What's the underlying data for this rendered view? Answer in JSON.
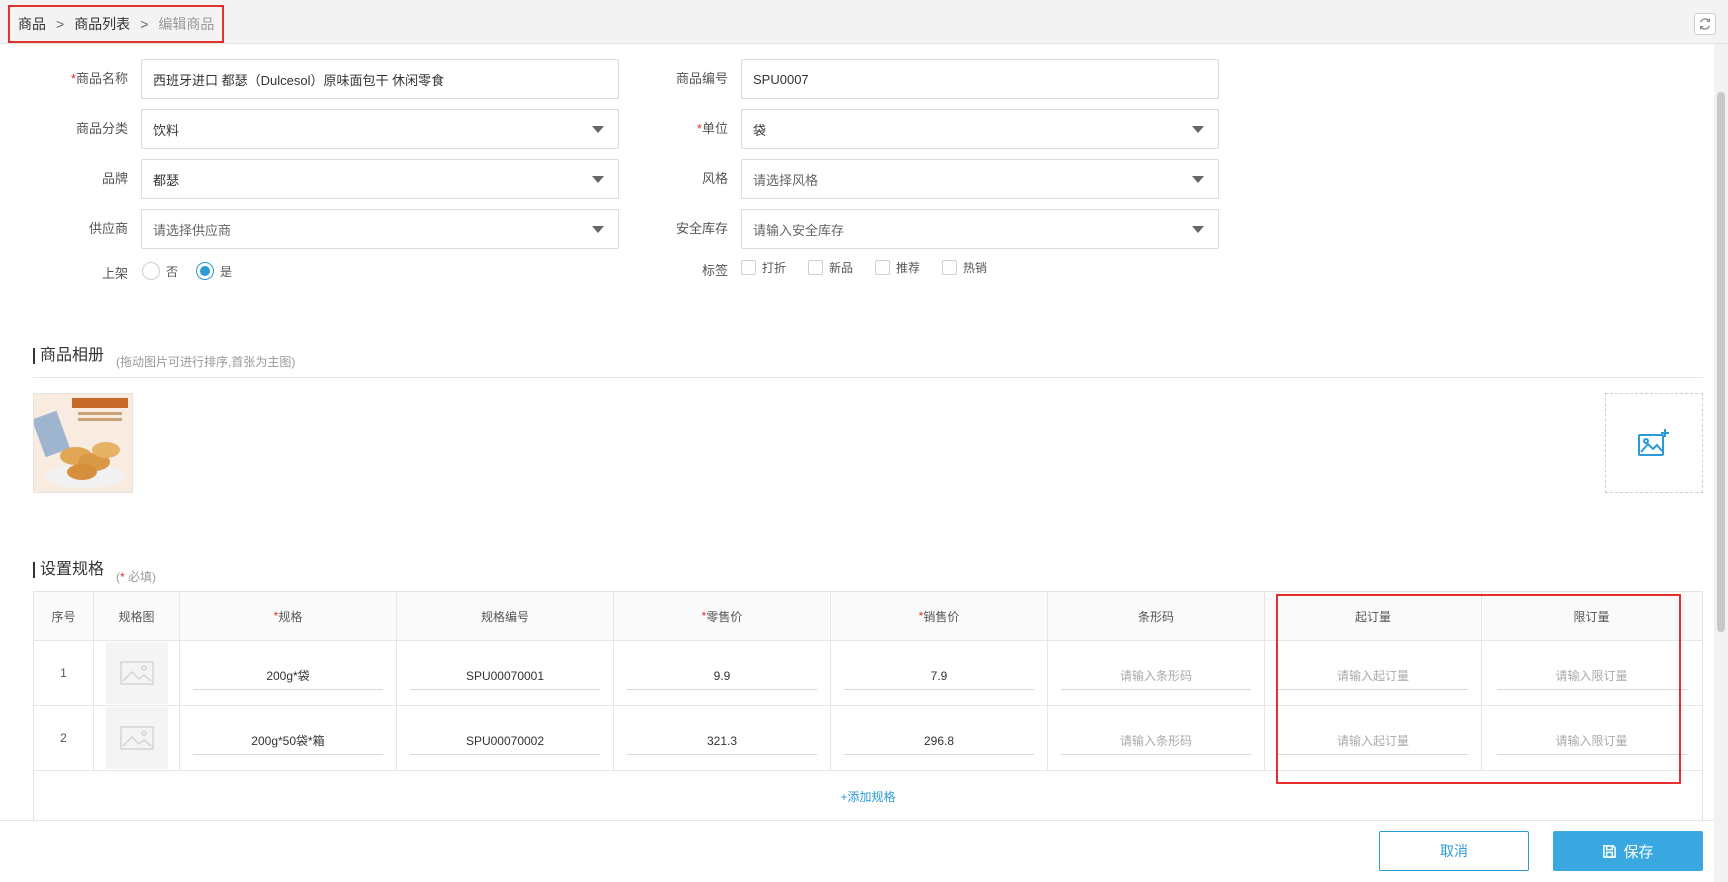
{
  "breadcrumb": {
    "items": [
      "商品",
      "商品列表",
      "编辑商品"
    ],
    "separator": ">"
  },
  "form": {
    "name": {
      "label": "商品名称",
      "value": "西班牙进口 都瑟（Dulcesol）原味面包干 休闲零食"
    },
    "code": {
      "label": "商品编号",
      "value": "SPU0007"
    },
    "category": {
      "label": "商品分类",
      "value": "饮料"
    },
    "unit": {
      "label": "单位",
      "value": "袋"
    },
    "brand": {
      "label": "品牌",
      "value": "都瑟"
    },
    "style": {
      "label": "风格",
      "placeholder": "请选择风格"
    },
    "supplier": {
      "label": "供应商",
      "placeholder": "请选择供应商"
    },
    "safety_stock": {
      "label": "安全库存",
      "placeholder": "请输入安全库存"
    },
    "on_shelf": {
      "label": "上架",
      "options": [
        "否",
        "是"
      ],
      "selected": "是"
    },
    "tags": {
      "label": "标签",
      "options": [
        "打折",
        "新品",
        "推荐",
        "热销"
      ]
    }
  },
  "album": {
    "title": "商品相册",
    "hint": "(拖动图片可进行排序,首张为主图)"
  },
  "spec": {
    "title": "设置规格",
    "hint_open": "(",
    "hint_req": "*",
    "hint_text": " 必填)",
    "columns": [
      "序号",
      "规格图",
      "规格",
      "规格编号",
      "零售价",
      "销售价",
      "条形码",
      "起订量",
      "限订量"
    ],
    "rows": [
      {
        "idx": "1",
        "spec": "200g*袋",
        "code": "SPU00070001",
        "retail": "9.9",
        "sale": "7.9"
      },
      {
        "idx": "2",
        "spec": "200g*50袋*箱",
        "code": "SPU00070002",
        "retail": "321.3",
        "sale": "296.8"
      }
    ],
    "placeholders": {
      "barcode": "请输入条形码",
      "min_order": "请输入起订量",
      "max_order": "请输入限订量"
    },
    "add_label": "+添加规格"
  },
  "footer": {
    "cancel": "取消",
    "save": "保存"
  },
  "colors": {
    "accent": "#2b9bd6",
    "required": "#e4302f",
    "highlight": "#e4302f"
  }
}
